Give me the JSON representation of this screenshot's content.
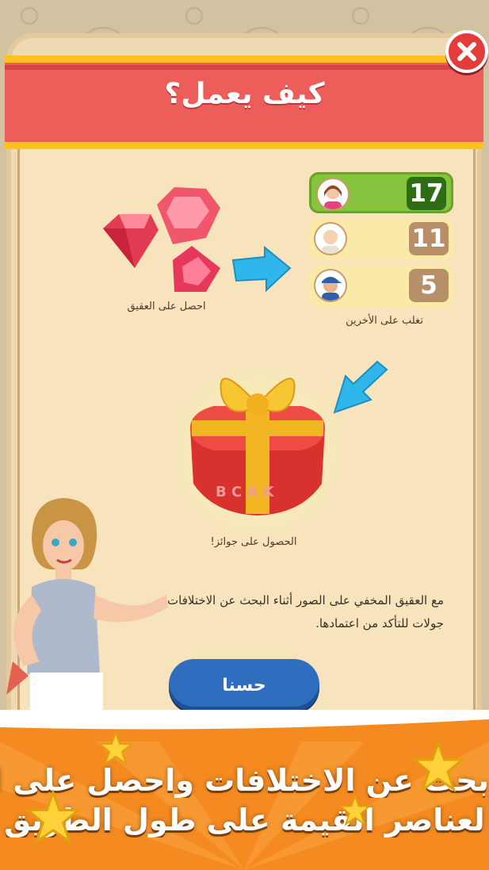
{
  "dialog": {
    "title": "كيف يعمل؟",
    "close_label": "✕"
  },
  "leaderboard": {
    "rows": [
      {
        "score": "17",
        "avatar": "woman-brown-hair-avatar",
        "highlight": true
      },
      {
        "score": "11",
        "avatar": "elderly-woman-avatar",
        "highlight": false
      },
      {
        "score": "5",
        "avatar": "man-blue-cap-avatar",
        "highlight": false
      }
    ],
    "caption": "تغلب على الأخرين"
  },
  "gems": {
    "caption": "احصل على العقيق"
  },
  "prize": {
    "caption": "الحصول على جوائز!",
    "gift_letters": "B C A K"
  },
  "description": {
    "line1": "مع العقيق المخفي على الصور أثناء البحث عن الاختلافات",
    "line2": "جولات للتأكد من اعتمادها."
  },
  "ok_button": {
    "label": "حسنا"
  },
  "promo_banner": {
    "line1": "بحث عن الاختلافات واحصل على ا",
    "line2": "لعناصر القيمة على طول الطريق"
  },
  "colors": {
    "header": "#ed5d5a",
    "gold_trim": "#ffc21a",
    "ok_button": "#2f6ebf",
    "banner": "#f48a20",
    "first_place": "#85c43c"
  }
}
